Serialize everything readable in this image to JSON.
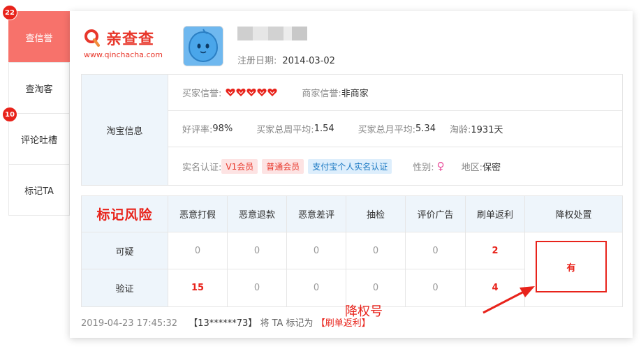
{
  "sidebar": {
    "items": [
      {
        "label": "查信誉",
        "badge": "22",
        "active": true
      },
      {
        "label": "查淘客",
        "badge": "",
        "active": false
      },
      {
        "label": "评论吐槽",
        "badge": "10",
        "active": false
      },
      {
        "label": "标记TA",
        "badge": "",
        "active": false
      }
    ]
  },
  "header": {
    "logo_name": "亲查查",
    "logo_url": "www.qinchacha.com",
    "reg_label": "注册日期:",
    "reg_date": "2014-03-02"
  },
  "info": {
    "section_label": "淘宝信息",
    "buyer_credit_label": "买家信誉:",
    "buyer_credit_hearts": 5,
    "seller_credit_label": "商家信誉:",
    "seller_credit_value": "非商家",
    "good_rate_label": "好评率:",
    "good_rate_value": "98%",
    "weekly_avg_label": "买家总周平均:",
    "weekly_avg_value": "1.54",
    "monthly_avg_label": "买家总月平均:",
    "monthly_avg_value": "5.34",
    "age_label": "淘龄:",
    "age_value": "1931天",
    "verify_label": "实名认证:",
    "verify_tags": [
      "V1会员",
      "普通会员",
      "支付宝个人实名认证"
    ],
    "gender_label": "性别:",
    "gender_value": "♀",
    "region_label": "地区:",
    "region_value": "保密"
  },
  "risk": {
    "title": "标记风险",
    "columns": [
      "恶意打假",
      "恶意退款",
      "恶意差评",
      "抽检",
      "评价广告",
      "刷单返利",
      "降权处置"
    ],
    "rows": [
      {
        "label": "可疑",
        "values": [
          "0",
          "0",
          "0",
          "0",
          "0",
          "2"
        ]
      },
      {
        "label": "验证",
        "values": [
          "15",
          "0",
          "0",
          "0",
          "0",
          "4"
        ]
      }
    ],
    "penalty_value": "有"
  },
  "footer": {
    "time": "2019-04-23 17:45:32",
    "user": "【13******73】",
    "text": "将 TA 标记为",
    "tag": "【刷单返利】"
  },
  "annotation": "降权号",
  "colors": {
    "accent": "#e8231b",
    "sidebar_active": "#f7726b",
    "header_bg": "#eef5fb"
  }
}
